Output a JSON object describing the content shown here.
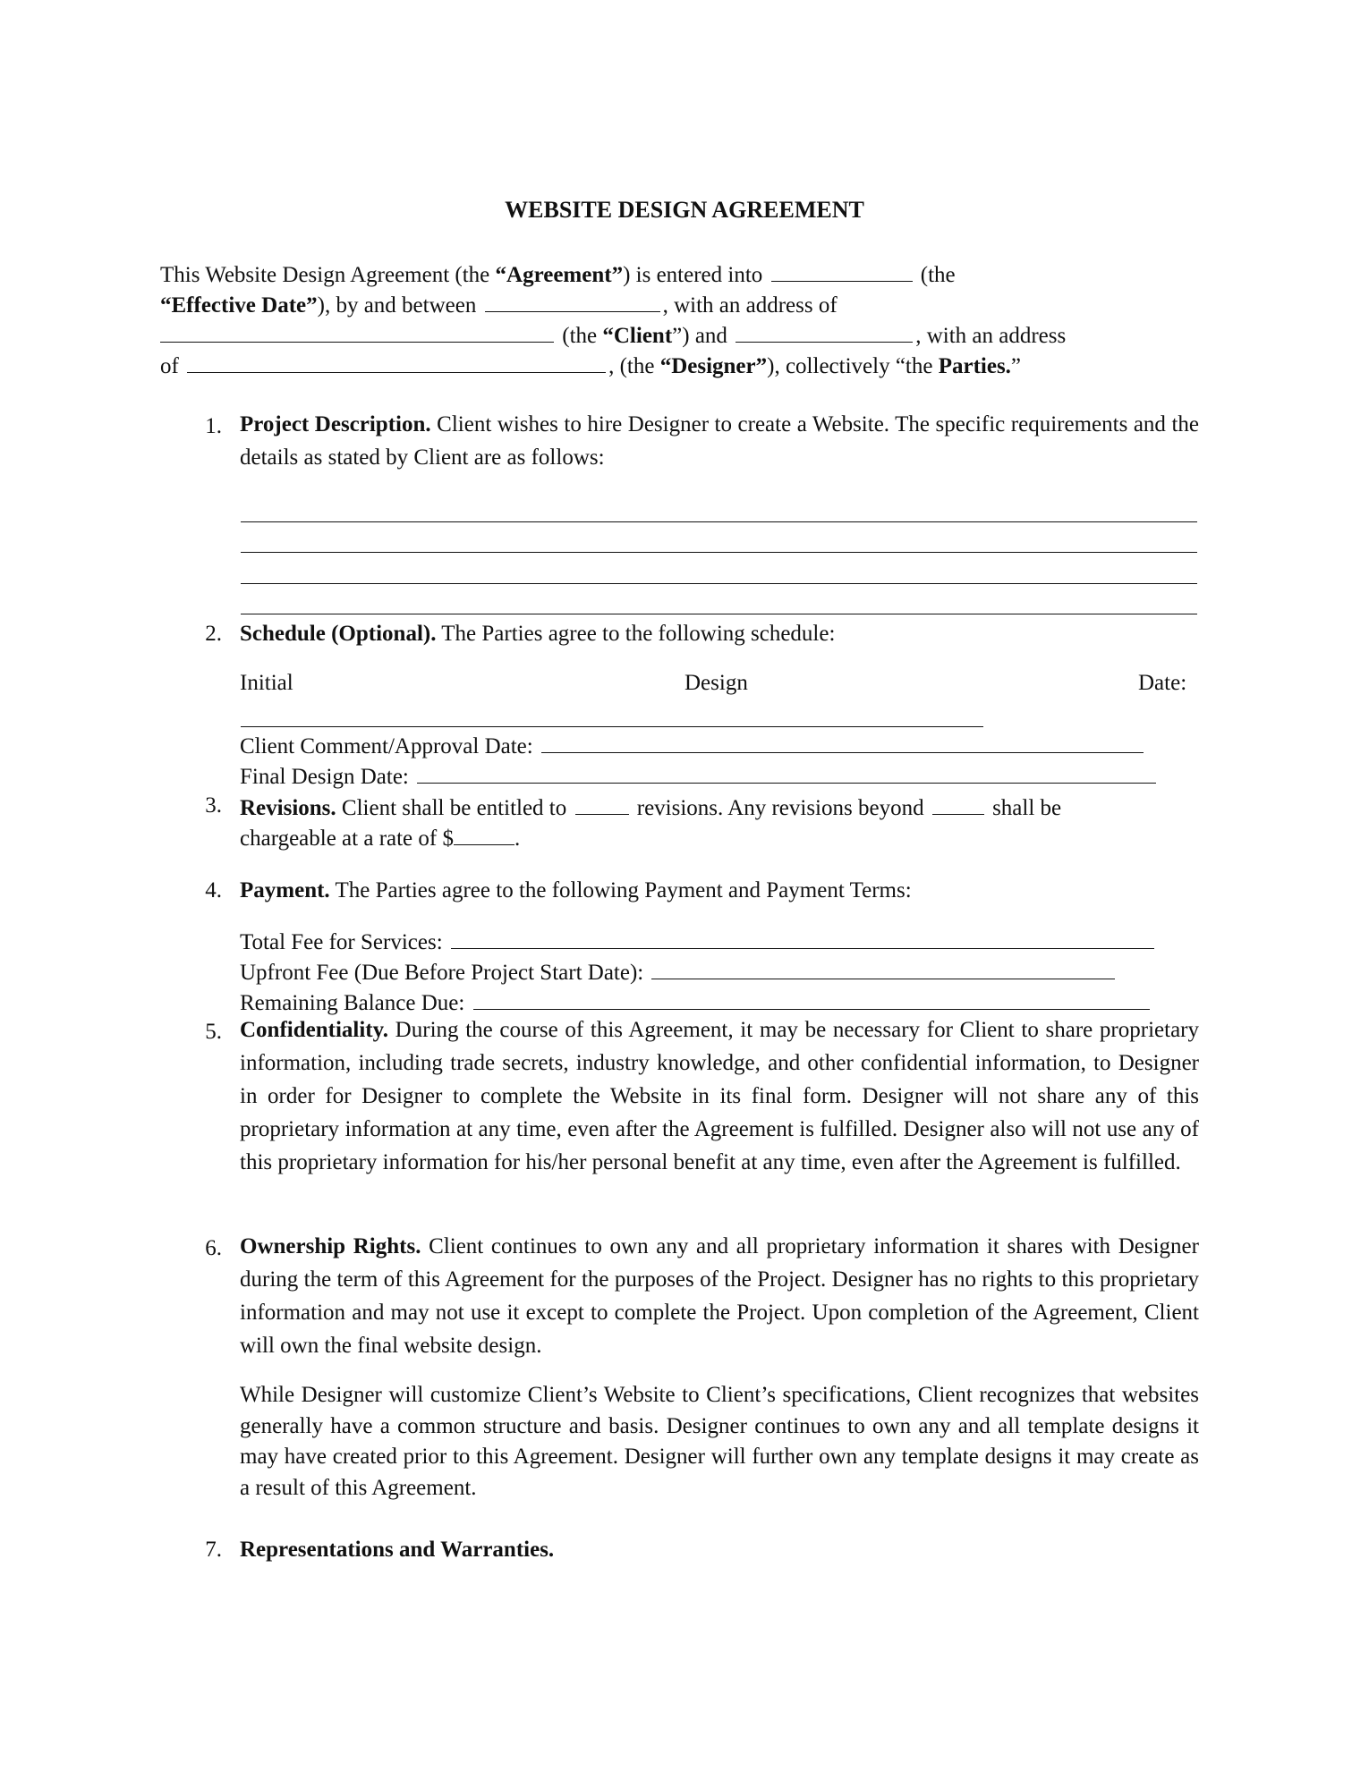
{
  "document": {
    "title": "WEBSITE DESIGN AGREEMENT",
    "intro": {
      "l1_a": "This Website Design Agreement (the ",
      "l1_b": "“Agreement”",
      "l1_c": ") is entered into",
      "l1_d": "(the",
      "l2_a": "“Effective Date”",
      "l2_b": "), by and between",
      "l2_c": ", with an address of",
      "l3_a": "(the ",
      "l3_b": "“Client",
      "l3_c": "”) and",
      "l3_d": ", with an address",
      "l4_a": "of",
      "l4_b": ", (the ",
      "l4_c": "“Designer”",
      "l4_d": "), collectively “the ",
      "l4_e": "Parties.",
      "l4_f": "”"
    },
    "sections": [
      {
        "number": "1.",
        "heading": "Project Description.",
        "text": " Client wishes to hire Designer to create a Website. The specific requirements and the details as stated by Client are as follows:"
      },
      {
        "number": "2.",
        "heading": "Schedule (Optional).",
        "text": " The Parties agree to the following schedule:",
        "schedule": {
          "initial": "Initial",
          "design": "Design",
          "date": "Date:",
          "client_comment": "Client Comment/Approval Date:",
          "final_design": "Final Design Date:"
        }
      },
      {
        "number": "3.",
        "heading": "Revisions.",
        "t1": " Client shall be entitled to",
        "t2": "revisions. Any revisions beyond",
        "t3": "shall be",
        "t4": "chargeable at a rate of $",
        "t5": "."
      },
      {
        "number": "4.",
        "heading": "Payment.",
        "text": " The Parties agree to the following Payment and Payment Terms:",
        "fields": {
          "total_fee": "Total Fee for Services:",
          "upfront_fee": "Upfront Fee (Due Before Project Start Date):",
          "remaining": "Remaining Balance Due:"
        }
      },
      {
        "number": "5.",
        "heading": "Confidentiality.",
        "text": " During the course of this Agreement, it may be necessary for Client to share proprietary information, including trade secrets, industry knowledge, and other confidential information, to Designer in order for Designer to complete the Website in its final form. Designer will not share any of this proprietary information at any time, even after the Agreement is fulfilled. Designer also will not use any of this proprietary information for his/her personal benefit at any time, even after the Agreement is fulfilled."
      },
      {
        "number": "6.",
        "heading": "Ownership Rights.",
        "text": " Client continues to own any and all proprietary information it shares with Designer during the term of this Agreement for the purposes of the Project. Designer has no rights to this proprietary information and may not use it except to complete the Project. Upon completion of the Agreement, Client will own the final website design.",
        "text2": "While Designer will customize Client’s Website to Client’s specifications, Client recognizes that websites generally have a common structure and basis. Designer continues to own any and all template designs it may have created prior to this Agreement. Designer will further own any template designs it may create as a result of this Agreement."
      },
      {
        "number": "7.",
        "heading": "Representations and Warranties."
      }
    ]
  }
}
